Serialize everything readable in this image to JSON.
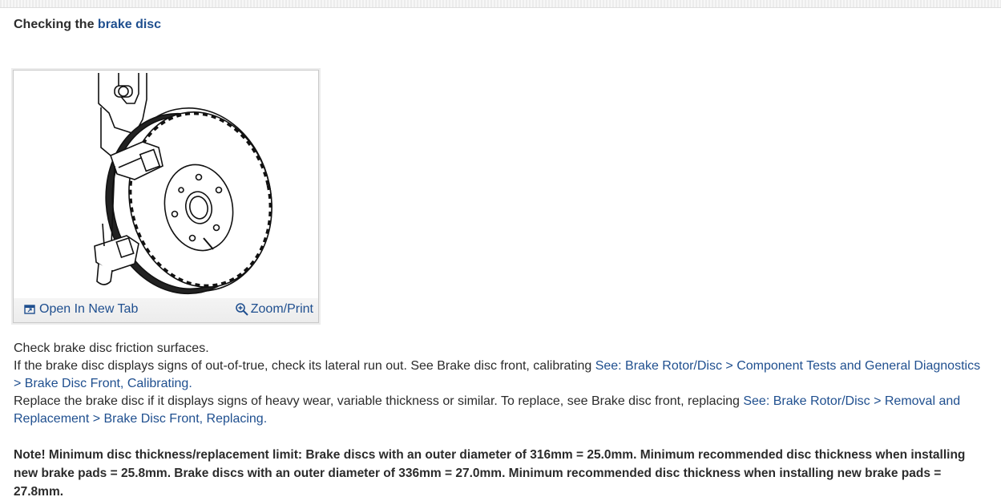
{
  "heading": {
    "prefix": "Checking the",
    "link": "brake disc"
  },
  "figure": {
    "alt": "Brake disc and caliper illustration",
    "open_tab_label": "Open In New Tab",
    "zoom_label": "Zoom/Print",
    "open_tab_icon": "open-in-new-tab-icon",
    "zoom_icon": "zoom-magnifier-icon"
  },
  "body": {
    "line1": "Check brake disc friction surfaces.",
    "para2_text": "If the brake disc displays signs of out-of-true, check its lateral run out. See Brake disc front, calibrating ",
    "para2_link": "See: Brake Rotor/Disc > Component Tests and General Diagnostics > Brake Disc Front, Calibrating",
    "para2_end": ".",
    "para3_text": "Replace the brake disc if it displays signs of heavy wear, variable thickness or similar. To replace, see Brake disc front, replacing ",
    "para3_link": "See: Brake Rotor/Disc > Removal and Replacement > Brake Disc Front, Replacing",
    "para3_end": "."
  },
  "note": {
    "text": "Note! Minimum disc thickness/replacement limit: Brake discs with an outer diameter of 316mm = 25.0mm. Minimum recommended disc thickness when installing new brake pads = 25.8mm. Brake discs with an outer diameter of 336mm = 27.0mm. Minimum recommended disc thickness when installing new brake pads = 27.8mm."
  },
  "colors": {
    "link": "#1f4f8f",
    "text": "#2b2b2b"
  }
}
